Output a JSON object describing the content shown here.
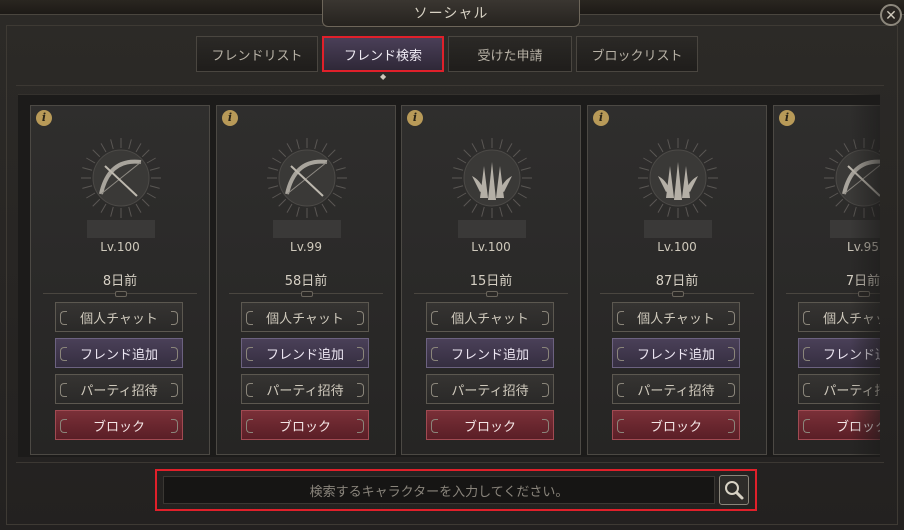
{
  "window": {
    "title": "ソーシャル",
    "close_symbol": "✕"
  },
  "tabs": [
    {
      "label": "フレンドリスト",
      "active": false
    },
    {
      "label": "フレンド検索",
      "active": true
    },
    {
      "label": "受けた申請",
      "active": false
    },
    {
      "label": "ブロックリスト",
      "active": false
    }
  ],
  "cards": [
    {
      "level": "Lv.100",
      "last_seen": "8日前",
      "emblem": "bow-emblem-icon"
    },
    {
      "level": "Lv.99",
      "last_seen": "58日前",
      "emblem": "bow-emblem-icon"
    },
    {
      "level": "Lv.100",
      "last_seen": "15日前",
      "emblem": "claw-emblem-icon"
    },
    {
      "level": "Lv.100",
      "last_seen": "87日前",
      "emblem": "claw-emblem-icon"
    },
    {
      "level": "Lv.95",
      "last_seen": "7日前",
      "emblem": "bow-emblem-icon"
    }
  ],
  "card_buttons": {
    "chat": "個人チャット",
    "add_friend": "フレンド追加",
    "party_invite": "パーティ招待",
    "block": "ブロック"
  },
  "info_icon_glyph": "i",
  "search": {
    "placeholder": "検索するキャラクターを入力してください。"
  },
  "colors": {
    "highlight": "#e0202a",
    "add_button": "#4a4058",
    "block_button": "#7a3038",
    "info_badge": "#b89a58"
  }
}
